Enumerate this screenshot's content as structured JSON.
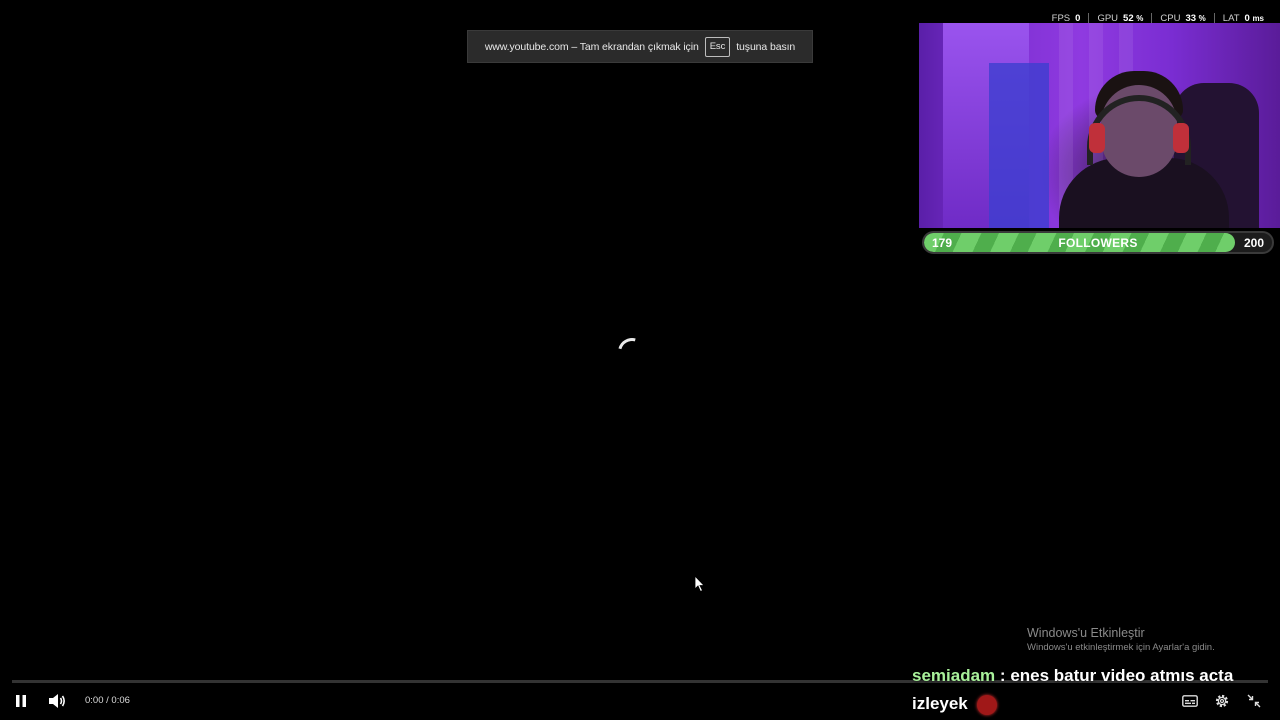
{
  "fullscreen_notice": {
    "prefix": "www.youtube.com – Tam ekrandan çıkmak için",
    "key": "Esc",
    "suffix": "tuşuna basın"
  },
  "stats": [
    {
      "label": "FPS",
      "value": "0",
      "unit": ""
    },
    {
      "label": "GPU",
      "value": "52",
      "unit": "%"
    },
    {
      "label": "CPU",
      "value": "33",
      "unit": "%"
    },
    {
      "label": "LAT",
      "value": "0",
      "unit": "ms"
    }
  ],
  "follower_goal": {
    "current": "179",
    "label": "FOLLOWERS",
    "target": "200",
    "progress_fraction": 0.895,
    "fill_color": "#5fbf5b"
  },
  "windows_activation": {
    "title": "Windows'u Etkinleştir",
    "subtitle": "Windows'u etkinleştirmek için Ayarlar'a gidin."
  },
  "player": {
    "time": "0:00 / 0:06",
    "icons": [
      "pause-icon",
      "volume-icon",
      "subtitles-icon",
      "settings-gear-icon",
      "exit-fullscreen-icon"
    ]
  },
  "chat": {
    "user": "semiadam",
    "separator": ":",
    "message": "enes batur video atmıs acta izleyek"
  }
}
